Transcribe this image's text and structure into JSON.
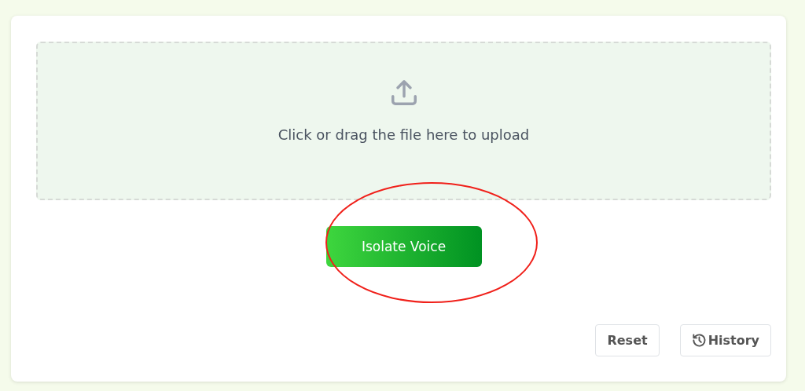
{
  "upload": {
    "prompt": "Click or drag the file here to upload"
  },
  "primary_action": {
    "label": "Isolate Voice"
  },
  "annotation": {
    "kind": "ellipse"
  },
  "footer_buttons": [
    {
      "label": "Reset",
      "kind": "plain"
    },
    {
      "label": "History",
      "kind": "history"
    }
  ]
}
